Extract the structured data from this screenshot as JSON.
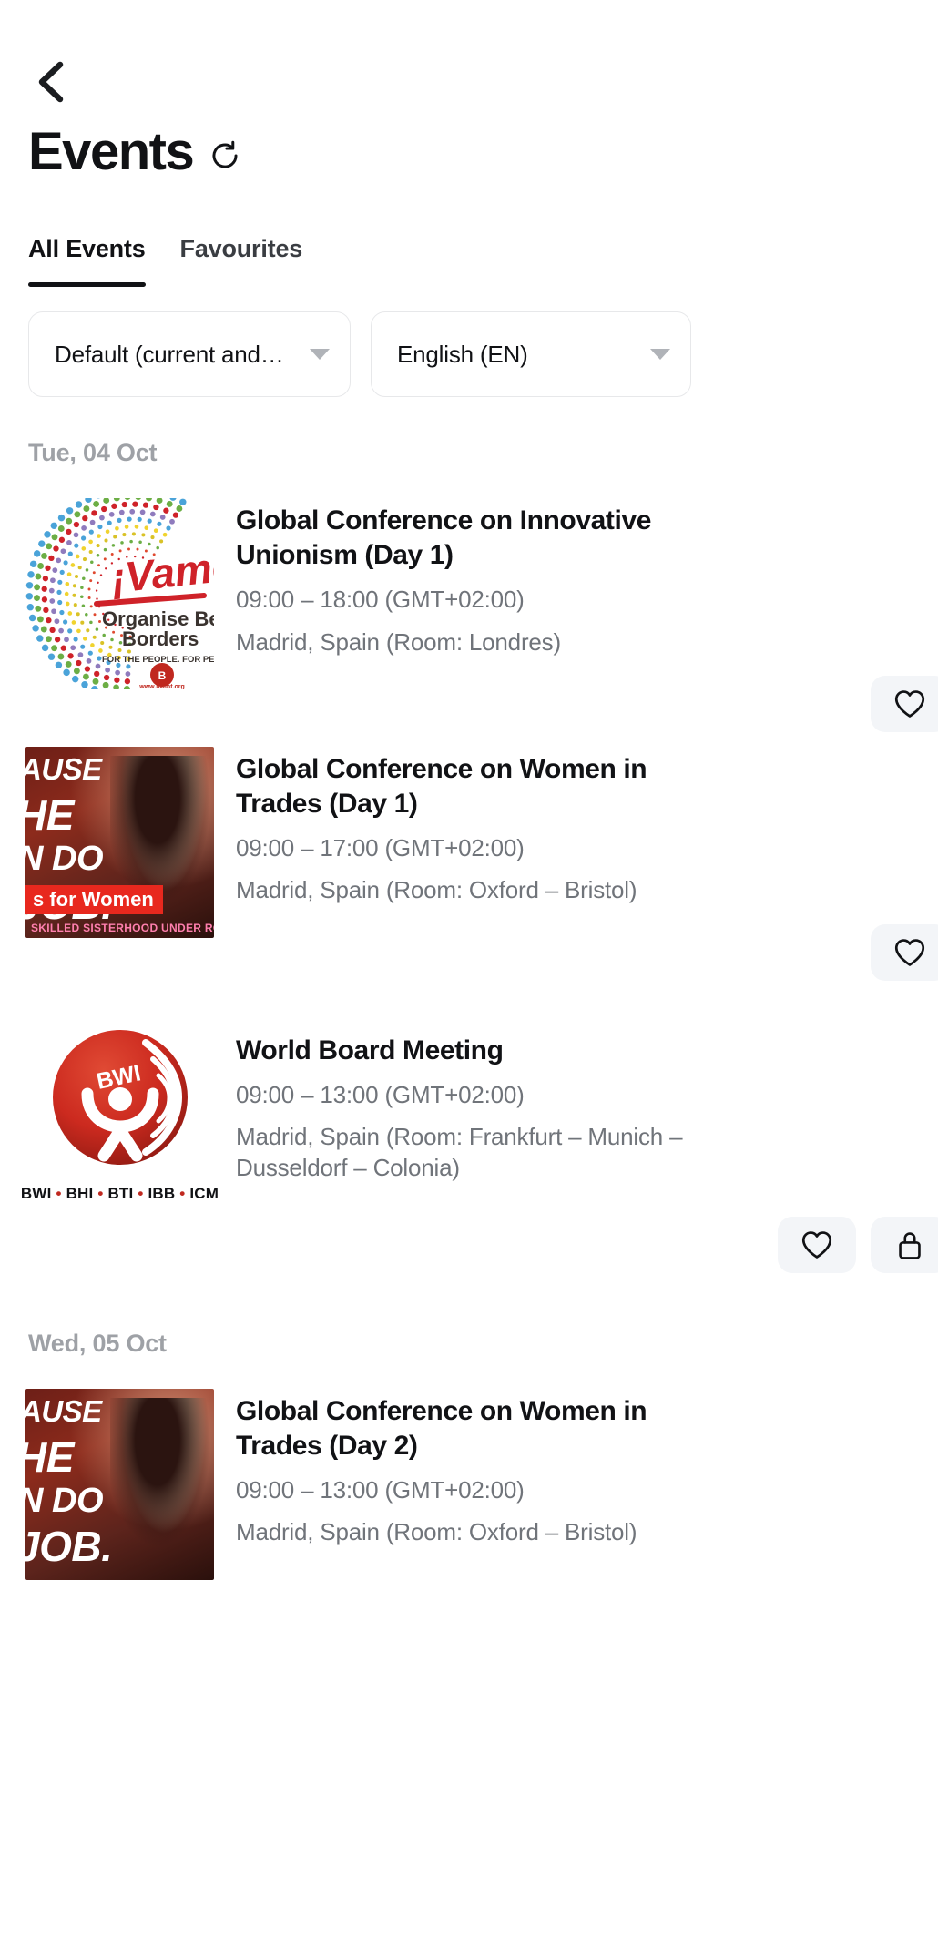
{
  "header": {
    "back_icon": "chevron-left-icon",
    "title": "Events",
    "refresh_icon": "refresh-icon"
  },
  "tabs": [
    {
      "label": "All Events",
      "active": true
    },
    {
      "label": "Favourites",
      "active": false
    }
  ],
  "filters": [
    {
      "name": "sort",
      "value": "Default (current and…",
      "icon": "chevron-down-icon"
    },
    {
      "name": "language",
      "value": "English (EN)",
      "icon": "chevron-down-icon"
    }
  ],
  "icons": {
    "favourite": "heart-icon",
    "restricted": "lock-icon"
  },
  "logos": {
    "vamos": {
      "title": "¡Vamos!",
      "line1": "Organise Beyond",
      "line2": "Borders",
      "tagline": "FOR THE PEOPLE. FOR PEACE. FOR THE PLANET",
      "url": "www.bwint.org"
    },
    "women": {
      "l1": "AUSE",
      "l2": "HE",
      "l3": "N DO",
      "l4": "JOB.",
      "badge": "s for Women",
      "foot": "SKILLED SISTERHOOD UNDER ROOFS"
    },
    "bwi": {
      "mark": "BWI",
      "caption": [
        "BWI",
        "BHI",
        "BTI",
        "IBB",
        "ICM"
      ]
    }
  },
  "colors": {
    "accent": "#c0281f",
    "text": "#111215",
    "muted": "#70747a",
    "day_header": "#9ea1a6",
    "chip_bg": "#f3f5f8"
  },
  "days": [
    {
      "label": "Tue, 04 Oct",
      "events": [
        {
          "title": "Global Conference on Innovative\nUnionism (Day 1)",
          "time": "09:00 – 18:00 (GMT+02:00)",
          "location": "Madrid, Spain (Room: Londres)",
          "thumb": "vamos",
          "actions": [
            "favourite"
          ]
        },
        {
          "title": "Global Conference on Women in\nTrades (Day 1)",
          "time": "09:00 – 17:00 (GMT+02:00)",
          "location": "Madrid, Spain (Room: Oxford – Bristol)",
          "thumb": "women",
          "actions": [
            "favourite"
          ]
        },
        {
          "title": "World Board Meeting",
          "time": "09:00 – 13:00 (GMT+02:00)",
          "location": "Madrid, Spain (Room: Frankfurt – Munich –\nDusseldorf – Colonia)",
          "thumb": "bwi",
          "actions": [
            "favourite",
            "restricted"
          ]
        }
      ]
    },
    {
      "label": "Wed, 05 Oct",
      "events": [
        {
          "title": "Global Conference on Women in\nTrades (Day 2)",
          "time": "09:00 – 13:00 (GMT+02:00)",
          "location": "Madrid, Spain (Room: Oxford – Bristol)",
          "thumb": "women",
          "actions": []
        }
      ]
    }
  ]
}
